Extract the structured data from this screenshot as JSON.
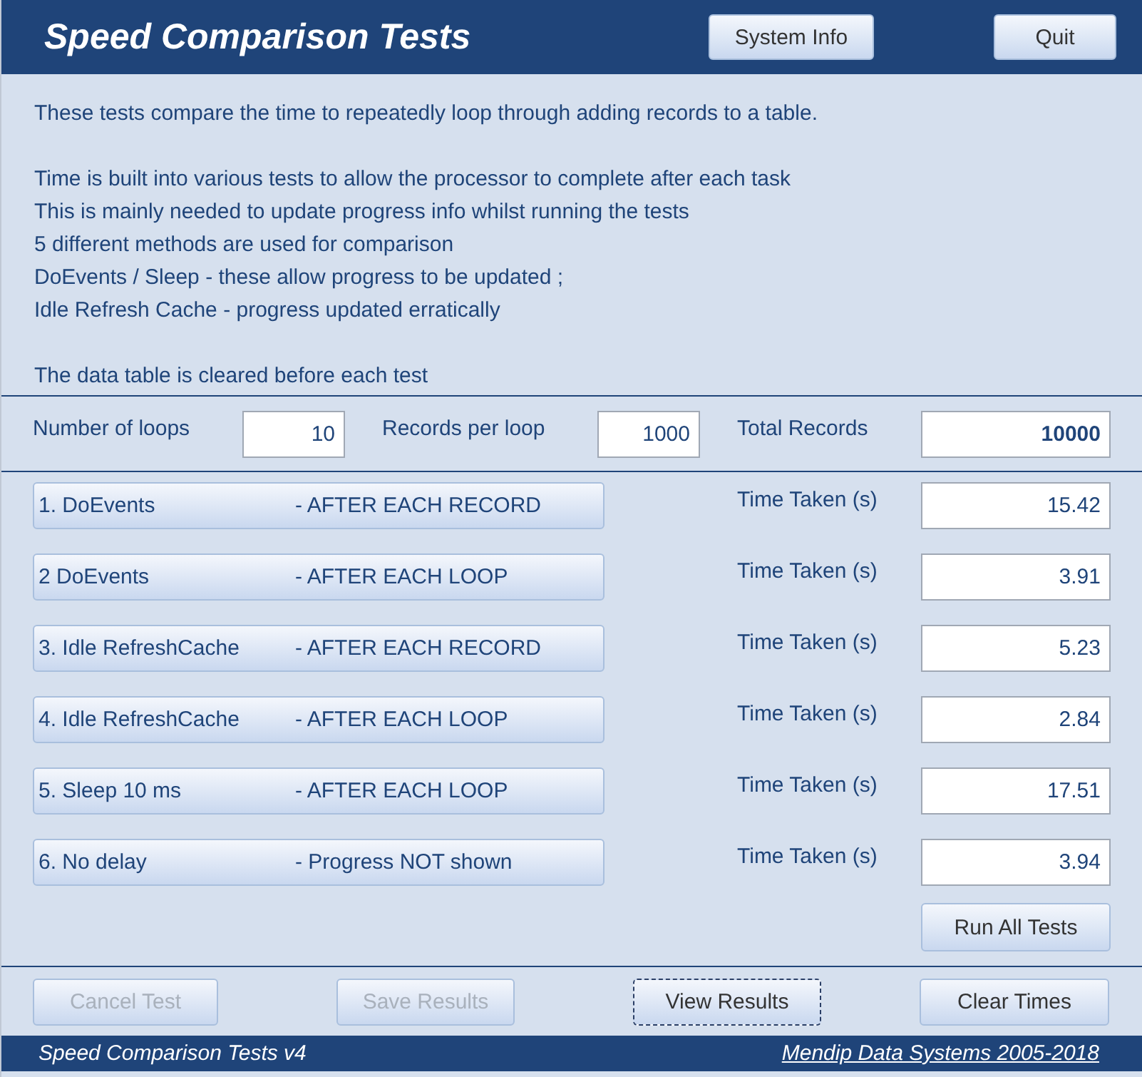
{
  "window": {
    "title": "Speed Comparison Tests"
  },
  "header_buttons": [
    {
      "label": "System Info"
    },
    {
      "label": "Quit"
    }
  ],
  "description": [
    [
      "These tests compare the time to repeatedly loop through adding records to a table."
    ],
    [
      "Time is built into various tests to allow the processor to complete after each task",
      "This is mainly needed to update progress info whilst running the tests",
      "5 different methods are used for comparison",
      "DoEvents / Sleep - these allow progress to be updated ;",
      "Idle Refresh Cache -  progress updated erratically"
    ],
    [
      "The data table is cleared before each test"
    ]
  ],
  "settings": [
    {
      "label": "Number of loops",
      "value": "10",
      "bold": false
    },
    {
      "label": "Records per loop",
      "value": "1000",
      "bold": false
    },
    {
      "label": "Total Records",
      "value": "10000",
      "bold": true
    }
  ],
  "tests": [
    {
      "name": "1. DoEvents",
      "mode": "- AFTER EACH RECORD",
      "time_label": "Time Taken (s)",
      "time": "15.42"
    },
    {
      "name": "2  DoEvents",
      "mode": "- AFTER EACH LOOP",
      "time_label": "Time Taken (s)",
      "time": "3.91"
    },
    {
      "name": "3. Idle RefreshCache",
      "mode": "- AFTER EACH RECORD",
      "time_label": "Time Taken (s)",
      "time": "5.23"
    },
    {
      "name": "4. Idle RefreshCache",
      "mode": "- AFTER EACH LOOP",
      "time_label": "Time Taken (s)",
      "time": "2.84"
    },
    {
      "name": "5. Sleep 10 ms",
      "mode": "- AFTER EACH LOOP",
      "time_label": "Time Taken (s)",
      "time": "17.51"
    },
    {
      "name": "6.  No delay",
      "mode": "- Progress NOT  shown",
      "time_label": "Time Taken (s)",
      "time": "3.94"
    }
  ],
  "run_all_button": {
    "label": "Run All Tests"
  },
  "bottom_buttons": [
    {
      "label": "Cancel Test",
      "disabled": true,
      "focused": false
    },
    {
      "label": "Save Results",
      "disabled": true,
      "focused": false
    },
    {
      "label": "View Results",
      "disabled": false,
      "focused": true
    },
    {
      "label": "Clear Times",
      "disabled": false,
      "focused": false
    }
  ],
  "footer": {
    "version": "Speed Comparison Tests v4",
    "link": "Mendip Data Systems 2005-2018"
  }
}
